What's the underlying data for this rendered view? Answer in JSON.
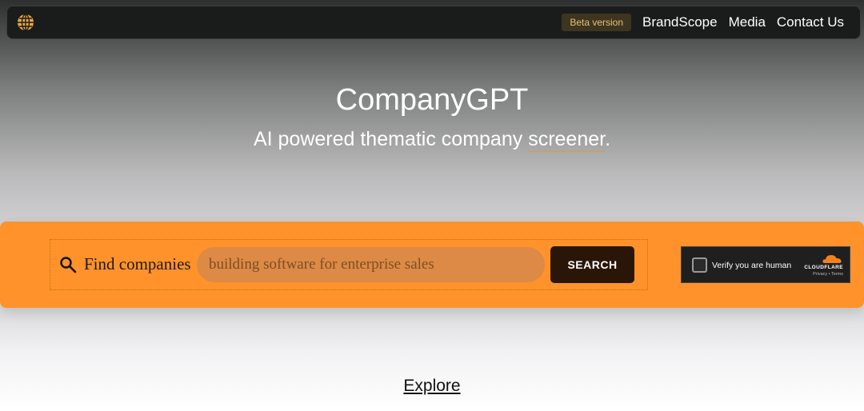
{
  "nav": {
    "beta_badge": "Beta version",
    "links": [
      "BrandScope",
      "Media",
      "Contact Us"
    ]
  },
  "hero": {
    "title": "CompanyGPT",
    "subtitle_prefix": "AI powered thematic company ",
    "subtitle_highlight": "screener",
    "subtitle_suffix": "."
  },
  "search": {
    "label": "Find companies",
    "placeholder": "building software for enterprise sales",
    "value": "",
    "button_label": "SEARCH"
  },
  "captcha": {
    "label": "Verify you are human",
    "brand": "CLOUDFLARE",
    "links": "Privacy • Terms"
  },
  "footer": {
    "explore_label": "Explore"
  },
  "colors": {
    "accent": "#ff922b",
    "button": "#2a1608",
    "navbar": "#1a1c1b"
  }
}
